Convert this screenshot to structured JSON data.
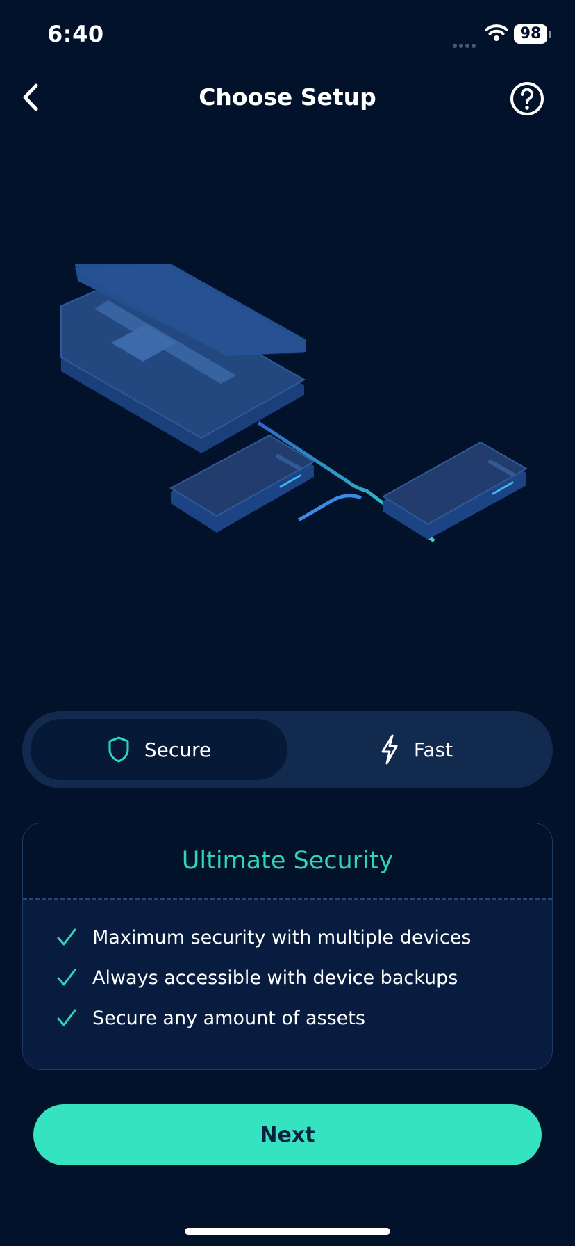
{
  "status_bar": {
    "time": "6:40",
    "battery": "98"
  },
  "nav": {
    "title": "Choose Setup",
    "back_icon": "chevron-left-icon",
    "help_icon": "question-circle-icon"
  },
  "segmented": {
    "selected": "secure",
    "options": [
      {
        "label": "Secure",
        "icon": "shield-icon"
      },
      {
        "label": "Fast",
        "icon": "lightning-icon"
      }
    ]
  },
  "card": {
    "title": "Ultimate Security",
    "features": [
      "Maximum security with multiple devices",
      "Always accessible with device backups",
      "Secure any amount of assets"
    ]
  },
  "next_button": {
    "label": "Next"
  },
  "colors": {
    "background": "#03122b",
    "accent": "#35e3c1",
    "title_accent": "#2fd6b6",
    "surface": "#132a4f"
  }
}
